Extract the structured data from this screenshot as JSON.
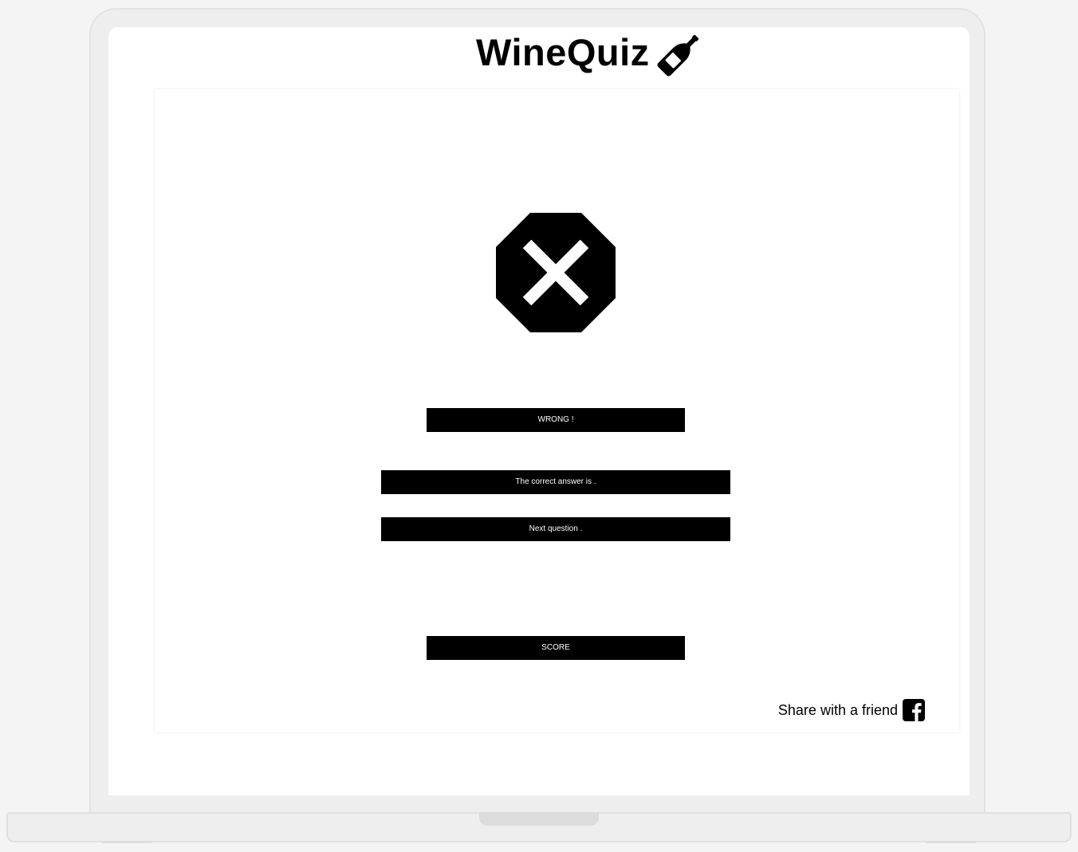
{
  "header": {
    "title": "WineQuiz",
    "title_icon": "wine-bottle-icon"
  },
  "result": {
    "icon": "octagon-x-icon",
    "status_label": "WRONG !",
    "correct_answer_label": "The correct answer is .",
    "next_question_label": "Next question .",
    "score_label": "SCORE"
  },
  "share": {
    "label": "Share with a friend",
    "icon": "facebook-icon"
  },
  "colors": {
    "bar_background": "#000000",
    "bar_text": "#ffffff",
    "page_background": "#ffffff"
  }
}
